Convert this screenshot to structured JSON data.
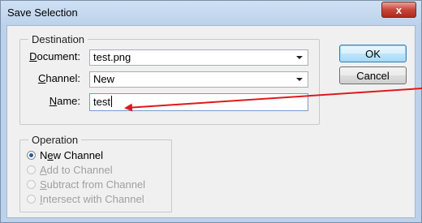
{
  "window": {
    "title": "Save Selection",
    "close_glyph": "x"
  },
  "destination": {
    "group_label": "Destination",
    "document": {
      "label_u": "D",
      "label_rest": "ocument:",
      "value": "test.png"
    },
    "channel": {
      "label_u": "C",
      "label_rest": "hannel:",
      "value": "New"
    },
    "name": {
      "label_u": "N",
      "label_rest": "ame:",
      "value": "test"
    }
  },
  "buttons": {
    "ok": "OK",
    "cancel": "Cancel"
  },
  "operation": {
    "group_label": "Operation",
    "options": [
      {
        "pre": "N",
        "u": "e",
        "post": "w Channel",
        "checked": true,
        "enabled": true
      },
      {
        "pre": "",
        "u": "A",
        "post": "dd to Channel",
        "checked": false,
        "enabled": false
      },
      {
        "pre": "",
        "u": "S",
        "post": "ubtract from Channel",
        "checked": false,
        "enabled": false
      },
      {
        "pre": "",
        "u": "I",
        "post": "ntersect with Channel",
        "checked": false,
        "enabled": false
      }
    ]
  },
  "colors": {
    "annotation_arrow": "#e0191b"
  }
}
